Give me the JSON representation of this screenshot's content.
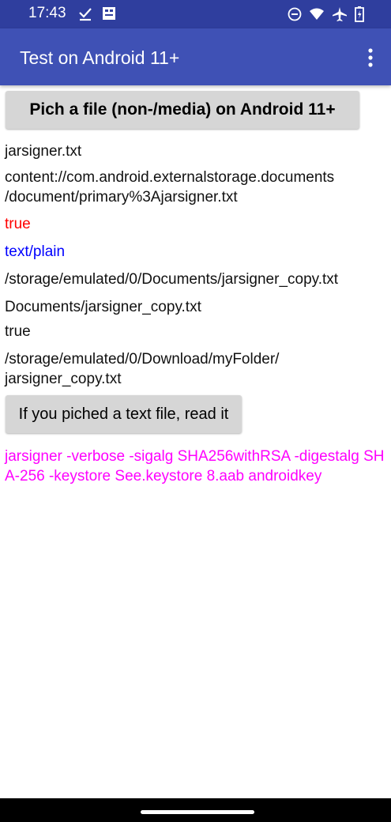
{
  "status_bar": {
    "time": "17:43",
    "left_icons": [
      "download-done-icon",
      "notification-app-icon"
    ],
    "right_icons": [
      "do-not-disturb-icon",
      "wifi-icon",
      "airplane-mode-icon",
      "battery-icon"
    ]
  },
  "app_bar": {
    "title": "Test on Android 11+",
    "menu_icon": "overflow-menu-icon"
  },
  "buttons": {
    "pick_file": "Pich a file (non-/media) on Android 11+",
    "read_text": "If you piched a text file, read it"
  },
  "results": {
    "file_name": "jarsigner.txt",
    "content_uri": "content://com.android.externalstorage.documents\n/document/primary%3Ajarsigner.txt",
    "is_text": "true",
    "mime_type": "text/plain",
    "copy_path": "/storage/emulated/0/Documents/jarsigner_copy.txt",
    "relative_path": "Documents/jarsigner_copy.txt",
    "copy_result": "true",
    "download_path": "/storage/emulated/0/Download/myFolder/\njarsigner_copy.txt",
    "file_text": "jarsigner -verbose -sigalg SHA256withRSA -digestalg SHA-256 -keystore See.keystore 8.aab androidkey"
  },
  "colors": {
    "status_bar": "#2f3e9e",
    "app_bar": "#3f51b5",
    "red_text": "#ff0000",
    "blue_text": "#0000ff",
    "magenta_text": "#ff00ff"
  }
}
